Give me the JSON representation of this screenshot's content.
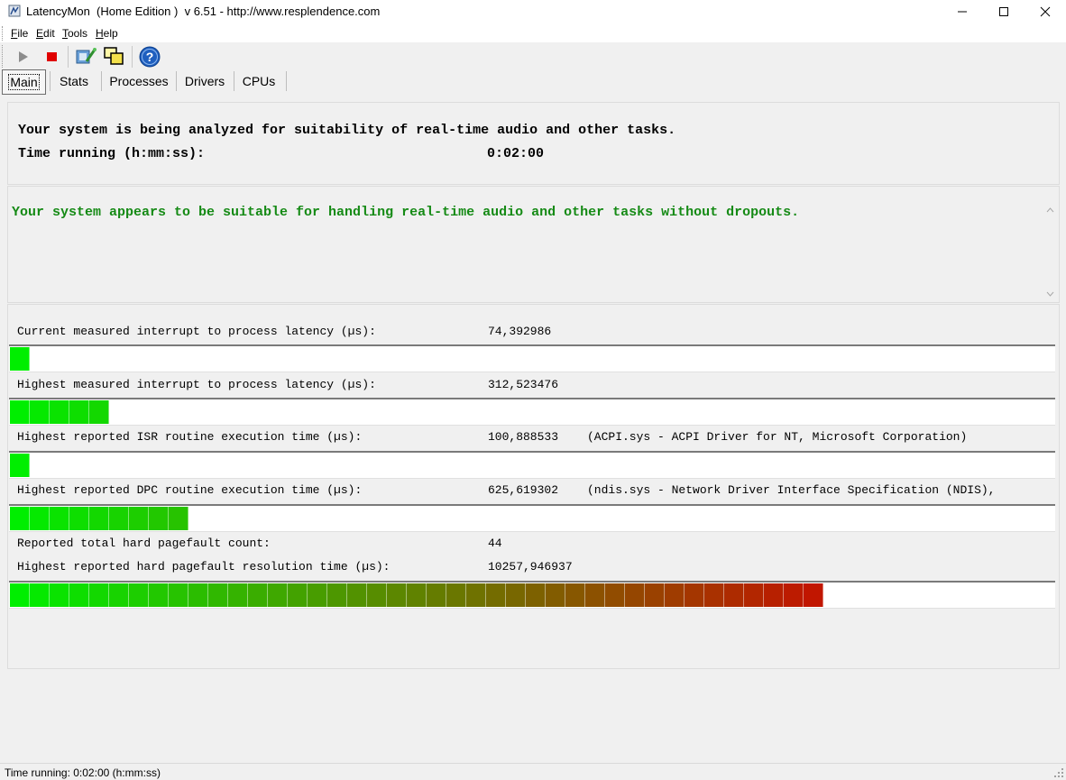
{
  "window": {
    "title": "LatencyMon  (Home Edition )  v 6.51 - http://www.resplendence.com",
    "minimize_icon": "minimize-icon",
    "maximize_icon": "maximize-icon",
    "close_icon": "close-icon"
  },
  "menu": {
    "items": [
      {
        "mnemonic": "F",
        "rest": "ile"
      },
      {
        "mnemonic": "E",
        "rest": "dit"
      },
      {
        "mnemonic": "T",
        "rest": "ools"
      },
      {
        "mnemonic": "H",
        "rest": "elp"
      }
    ]
  },
  "toolbar": {
    "buttons": [
      "play-icon",
      "stop-icon",
      "driver-icon",
      "windows-icon",
      "help-icon"
    ],
    "colors": {
      "play": "#8c8c8c",
      "stop": "#e00000",
      "help": "#1f5fbf"
    }
  },
  "tabs": [
    "Main",
    "Stats",
    "Processes",
    "Drivers",
    "CPUs"
  ],
  "analysis": {
    "status_line": "Your system is being analyzed for suitability of real-time audio and other tasks.",
    "time_label": "Time running (h:mm:ss):",
    "time_value": "0:02:00"
  },
  "verdict": {
    "text": "Your system appears to be suitable for handling real-time audio and other tasks without dropouts.",
    "color": "#158a15"
  },
  "metrics": [
    {
      "label": "Current measured interrupt to process latency (µs):",
      "value": "74,392986",
      "detail": "",
      "bar_fraction": 0.017
    },
    {
      "label": "Highest measured interrupt to process latency (µs):",
      "value": "312,523476",
      "detail": "",
      "bar_fraction": 0.089
    },
    {
      "label": "Highest reported ISR routine execution time (µs):",
      "value": "100,888533",
      "detail": "(ACPI.sys - ACPI Driver for NT, Microsoft Corporation)",
      "bar_fraction": 0.018
    },
    {
      "label": "Highest reported DPC routine execution time (µs):",
      "value": "625,619302",
      "detail": "(ndis.sys - Network Driver Interface Specification (NDIS),",
      "bar_fraction": 0.169
    },
    {
      "label": "Reported total hard pagefault count:",
      "value": "44",
      "detail": ""
    },
    {
      "label": "Highest reported hard pagefault resolution time (µs):",
      "value": "10257,946937",
      "detail": "",
      "bar_fraction": 0.776
    }
  ],
  "bar_colors": {
    "start": "#00ee00",
    "end": "#d40000"
  },
  "statusbar": {
    "text": "Time running: 0:02:00  (h:mm:ss)"
  }
}
